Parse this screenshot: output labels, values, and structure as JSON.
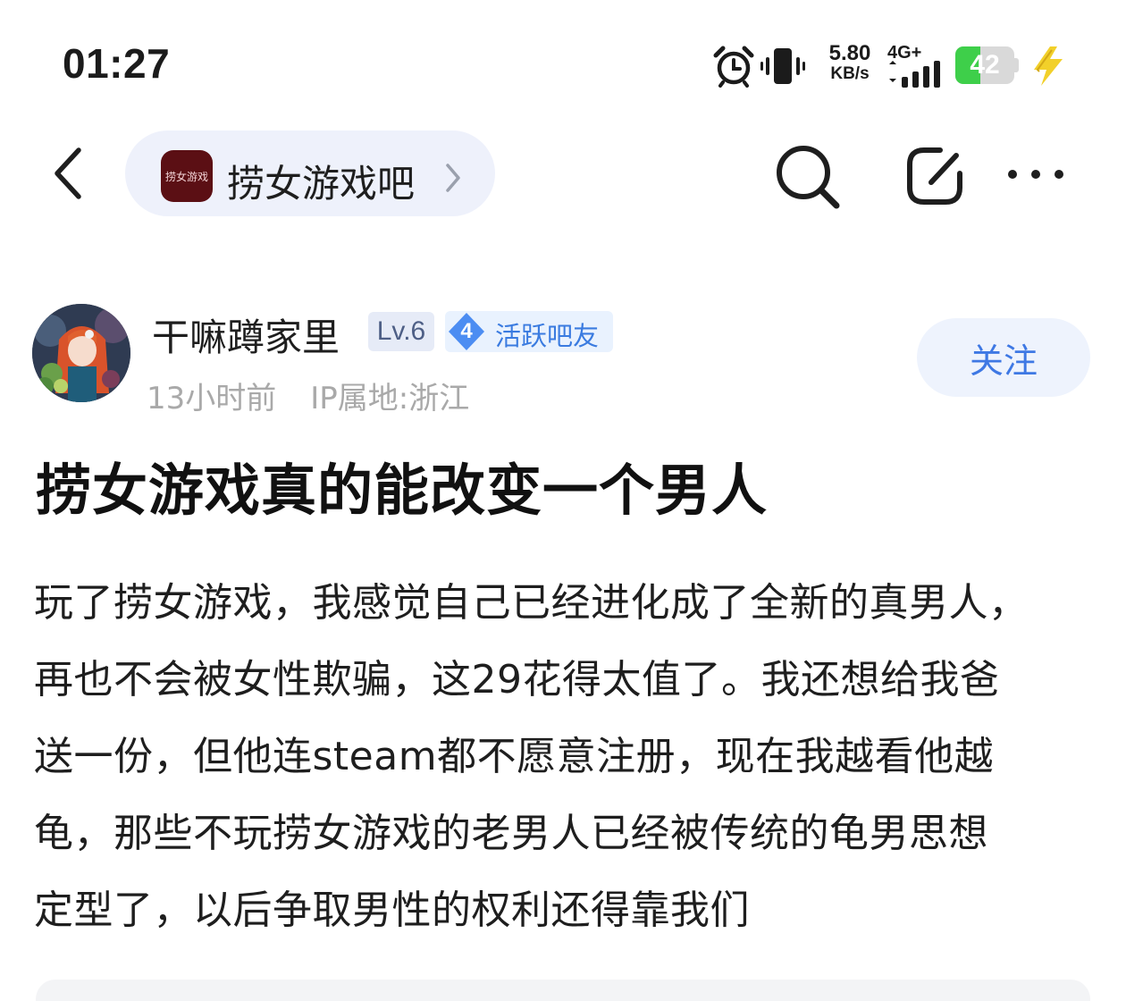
{
  "status_bar": {
    "time": "01:27",
    "net_speed_value": "5.80",
    "net_speed_unit": "KB/s",
    "network_type": "4G+",
    "battery_level": "42",
    "battery_fraction": 0.42,
    "icons": [
      "alarm-icon",
      "vibrate-icon",
      "signal-icon",
      "charging-icon"
    ]
  },
  "header": {
    "forum_name": "捞女游戏吧",
    "forum_logo_text": "捞女游戏",
    "icons": [
      "back-icon",
      "chevron-right-icon",
      "search-icon",
      "share-icon",
      "more-icon"
    ]
  },
  "author": {
    "name": "干嘛蹲家里",
    "level": "Lv.6",
    "active_level": "4",
    "active_label": "活跃吧友",
    "time_ago": "13小时前",
    "ip_location": "IP属地:浙江",
    "follow_label": "关注"
  },
  "post": {
    "title": "捞女游戏真的能改变一个男人",
    "body_lines": [
      "玩了捞女游戏，我感觉自己已经进化成了全新的真男人，",
      "再也不会被女性欺骗，这29花得太值了。我还想给我爸",
      "送一份，但他连steam都不愿意注册，现在我越看他越",
      "龟，那些不玩捞女游戏的老男人已经被传统的龟男思想",
      "定型了，以后争取男性的权利还得靠我们"
    ]
  },
  "colors": {
    "accent_blue": "#3e78e4",
    "battery_green": "#3ecf4a",
    "charging_yellow": "#f2d02a",
    "pill_background": "#eef1fb"
  }
}
